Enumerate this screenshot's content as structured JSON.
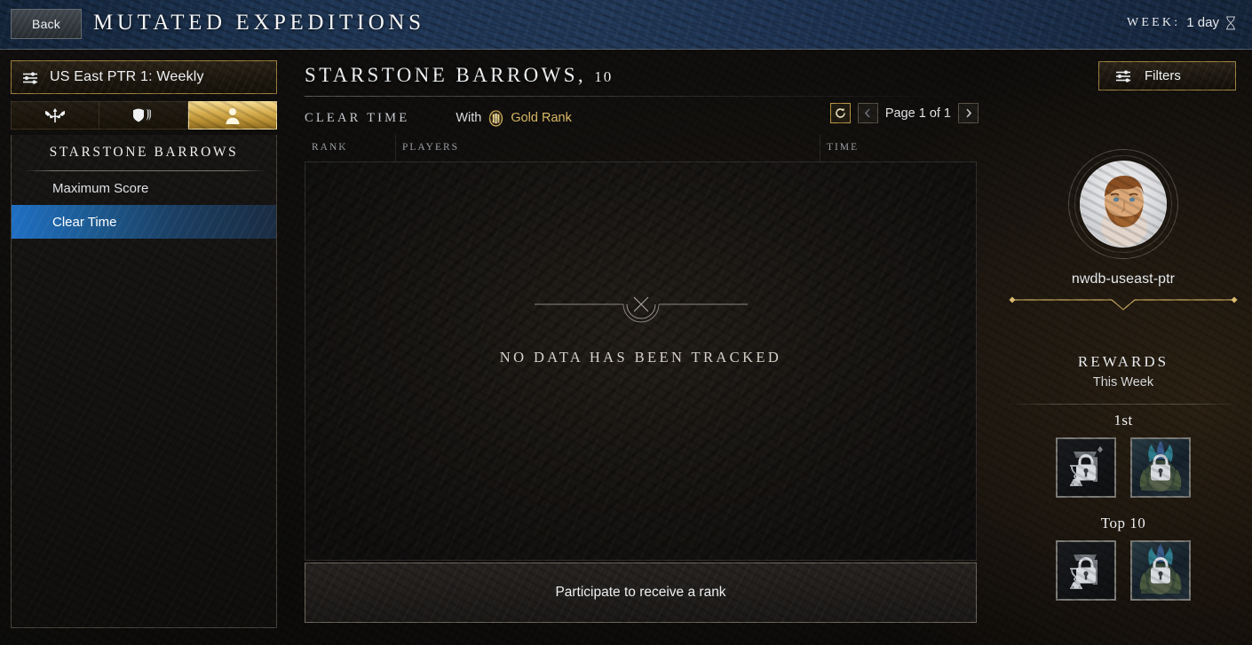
{
  "header": {
    "back_label": "Back",
    "title": "MUTATED EXPEDITIONS",
    "week_label": "WEEK:",
    "week_value": "1 day",
    "hourglass_icon": "hourglass-icon"
  },
  "sidebar": {
    "server_selector": {
      "label": "US East PTR 1: Weekly",
      "icon": "sliders-icon"
    },
    "tabs": [
      {
        "name": "war-icon",
        "active": false
      },
      {
        "name": "shields-icon",
        "active": false
      },
      {
        "name": "person-icon",
        "active": true
      }
    ],
    "section_title": "STARSTONE BARROWS",
    "items": [
      {
        "label": "Maximum Score",
        "active": false
      },
      {
        "label": "Clear Time",
        "active": true
      }
    ]
  },
  "main": {
    "board_title": "STARSTONE BARROWS,",
    "board_level": "10",
    "mode_label": "CLEAR TIME",
    "with_text": "With",
    "rank_text": "Gold Rank",
    "rank_medal_icon": "gold-medal-icon",
    "pager": {
      "refresh_icon": "refresh-icon",
      "prev_icon": "chevron-left-icon",
      "next_icon": "chevron-right-icon",
      "page_text": "Page 1 of 1"
    },
    "columns": [
      "RANK",
      "PLAYERS",
      "TIME"
    ],
    "empty_state": {
      "ornament_icon": "x-ornament-icon",
      "message": "NO DATA HAS BEEN TRACKED"
    },
    "participate_label": "Participate to receive a rank"
  },
  "right": {
    "filters": {
      "label": "Filters",
      "icon": "sliders-icon"
    },
    "profile": {
      "avatar_icon": "character-portrait",
      "username": "nwdb-useast-ptr"
    },
    "divider_icon": "gold-chevron-divider",
    "rewards": {
      "title": "REWARDS",
      "subtitle": "This Week",
      "tiers": [
        {
          "label": "1st",
          "label_sup": "",
          "items": [
            {
              "name": "locked-reward-hourglass",
              "lock_icon": "lock-icon"
            },
            {
              "name": "locked-reward-armor",
              "lock_icon": "lock-icon"
            }
          ]
        },
        {
          "label": "Top 10",
          "label_sup": "",
          "items": [
            {
              "name": "locked-reward-hourglass",
              "lock_icon": "lock-icon"
            },
            {
              "name": "locked-reward-armor",
              "lock_icon": "lock-icon"
            }
          ]
        }
      ]
    }
  },
  "colors": {
    "gold": "#d4af5a",
    "gold_border": "#a08440",
    "header_blue": "#22395a",
    "active_blue": "#1f6fc4"
  }
}
